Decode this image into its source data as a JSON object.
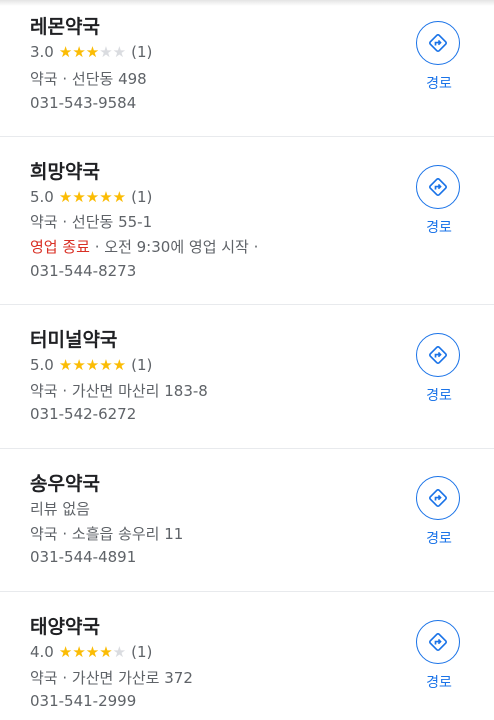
{
  "places": [
    {
      "name": "레몬약국",
      "rating": "3.0",
      "stars_filled": 3,
      "review_count": "(1)",
      "category_address": "약국 · 선단동 498",
      "phone": "031-543-9584",
      "directions_label": "경로"
    },
    {
      "name": "희망약국",
      "rating": "5.0",
      "stars_filled": 5,
      "review_count": "(1)",
      "category_address": "약국 · 선단동 55-1",
      "status_closed": "영업 종료",
      "status_rest": " · 오전 9:30에 영업 시작 ·",
      "phone": "031-544-8273",
      "directions_label": "경로"
    },
    {
      "name": "터미널약국",
      "rating": "5.0",
      "stars_filled": 5,
      "review_count": "(1)",
      "category_address": "약국 · 가산면 마산리 183-8",
      "phone": "031-542-6272",
      "directions_label": "경로"
    },
    {
      "name": "송우약국",
      "no_reviews": "리뷰 없음",
      "category_address": "약국 · 소흘읍 송우리 11",
      "phone": "031-544-4891",
      "directions_label": "경로"
    },
    {
      "name": "태양약국",
      "rating": "4.0",
      "stars_filled": 4,
      "review_count": "(1)",
      "category_address": "약국 · 가산면 가산로 372",
      "phone": "031-541-2999",
      "directions_label": "경로"
    }
  ],
  "colors": {
    "accent": "#1a73e8",
    "star": "#fbbc04",
    "closed": "#d93025"
  },
  "icons": {
    "directions": "directions-icon"
  }
}
